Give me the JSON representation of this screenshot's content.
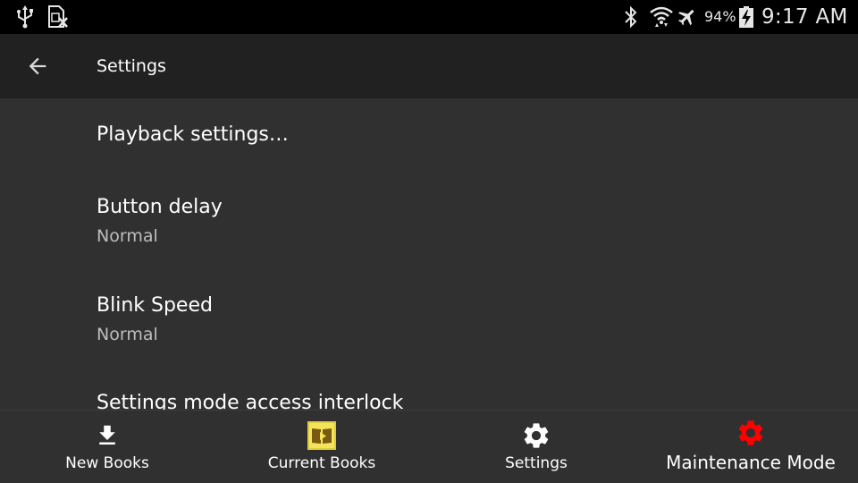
{
  "status_bar": {
    "battery_percent": "94%",
    "time": "9:17 AM",
    "icons": [
      "usb-icon",
      "sim-card-icon",
      "bluetooth-icon",
      "wifi-icon",
      "airplane-mode-icon",
      "battery-charging-icon"
    ]
  },
  "toolbar": {
    "back_icon": "arrow-back-icon",
    "title": "Settings"
  },
  "settings": {
    "items": [
      {
        "title": "Playback settings…",
        "summary": ""
      },
      {
        "title": "Button delay",
        "summary": "Normal"
      },
      {
        "title": "Blink Speed",
        "summary": "Normal"
      },
      {
        "title": "Settings mode access interlock",
        "summary": ""
      }
    ]
  },
  "bottom_nav": {
    "items": [
      {
        "label": "New Books",
        "icon": "download-icon"
      },
      {
        "label": "Current Books",
        "icon": "book-icon"
      },
      {
        "label": "Settings",
        "icon": "gear-icon"
      },
      {
        "label": "Maintenance Mode",
        "icon": "gear-icon"
      }
    ]
  },
  "colors": {
    "status_bar_bg": "#000000",
    "toolbar_bg": "#212121",
    "content_bg": "#303030",
    "primary_text": "#ffffff",
    "secondary_text": "#bdbdbd",
    "book_icon_fill": "#f0e04a",
    "maintenance_icon": "#ff0000"
  }
}
